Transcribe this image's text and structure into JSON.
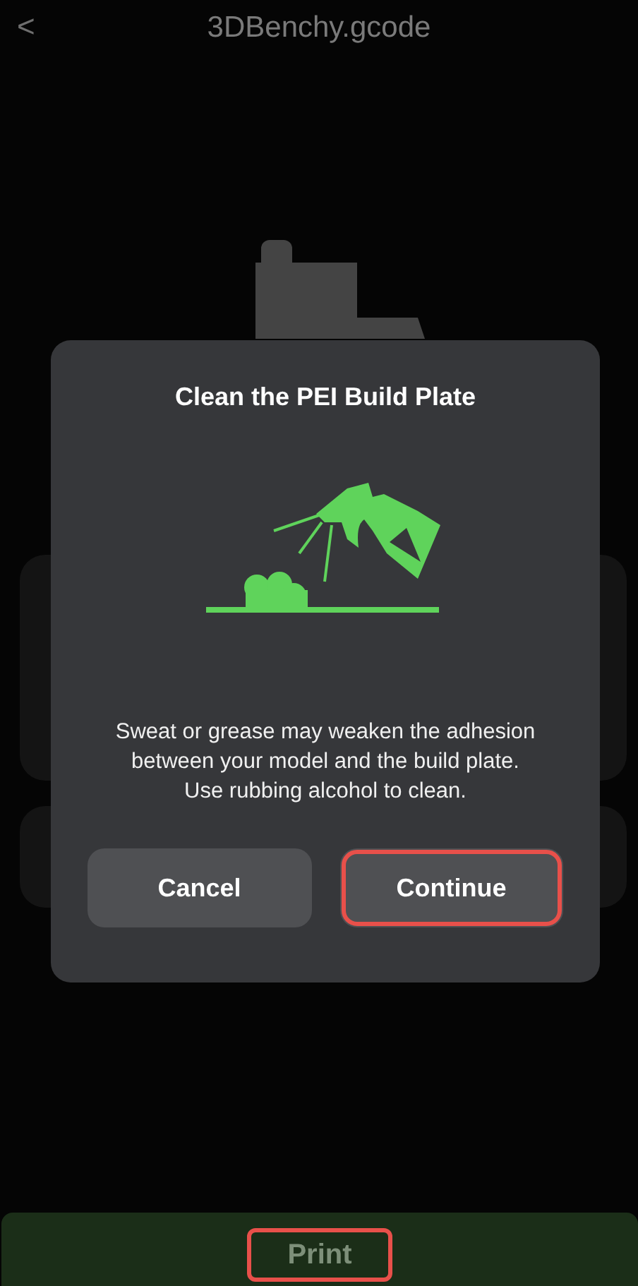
{
  "header": {
    "back": "<",
    "title": "3DBenchy.gcode"
  },
  "dialog": {
    "title": "Clean the PEI Build Plate",
    "message": "Sweat or grease may weaken the adhesion between your model and the build plate. Use rubbing alcohol to clean.",
    "buttons": [
      {
        "label": "Cancel",
        "highlighted": false
      },
      {
        "label": "Continue",
        "highlighted": true
      }
    ]
  },
  "print_button": {
    "label": "Print",
    "highlighted": true
  }
}
